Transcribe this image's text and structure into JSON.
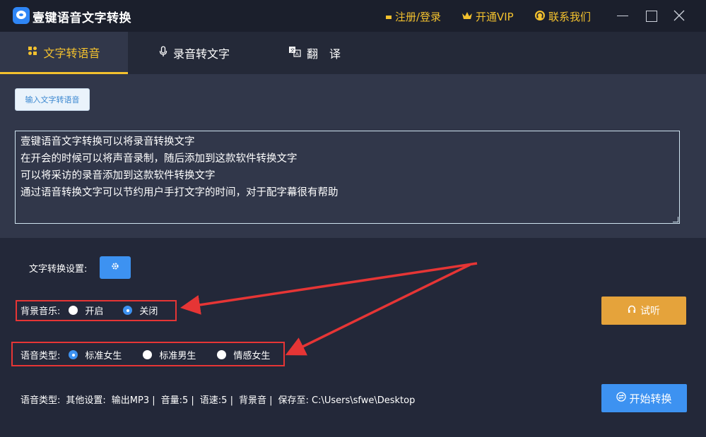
{
  "app": {
    "title": "壹键语音文字转换",
    "register_label": "注册/登录",
    "vip_label": "开通VIP",
    "contact_label": "联系我们"
  },
  "tabs": [
    {
      "label": "文字转语音",
      "icon": "text-speech-icon",
      "active": true
    },
    {
      "label": "录音转文字",
      "icon": "microphone-icon",
      "active": false
    },
    {
      "label": "翻　译",
      "icon": "translate-icon",
      "active": false
    }
  ],
  "input_button_label": "输入文字转语音",
  "textarea_lines": [
    "壹键语音文字转换可以将录音转换文字",
    "在开会的时候可以将声音录制，随后添加到这款软件转换文字",
    "可以将采访的录音添加到这款软件转换文字",
    "通过语音转换文字可以节约用户手打文字的时间，对于配字幕很有帮助"
  ],
  "settings": {
    "label": "文字转换设置:"
  },
  "background_music": {
    "label": "背景音乐:",
    "options": [
      {
        "label": "开启",
        "checked": false
      },
      {
        "label": "关闭",
        "checked": true
      }
    ]
  },
  "voice_type": {
    "label": "语音类型:",
    "options": [
      {
        "label": "标准女生",
        "checked": true
      },
      {
        "label": "标准男生",
        "checked": false
      },
      {
        "label": "情感女生",
        "checked": false
      }
    ]
  },
  "listen_button_label": "试听",
  "start_button_label": "开始转换",
  "status": {
    "voice_type_label": "语音类型:",
    "other_settings_label": "其他设置:",
    "output": "输出MP3 |",
    "volume": "音量:5 |",
    "speed": "语速:5 |",
    "bg_sound": "背景音 |",
    "save_to": "保存至: C:\\Users\\sfwe\\Desktop"
  },
  "colors": {
    "accent": "#3d92f1",
    "highlight": "#f3c12e",
    "listen": "#e5a33b",
    "annotation": "#e63535"
  }
}
